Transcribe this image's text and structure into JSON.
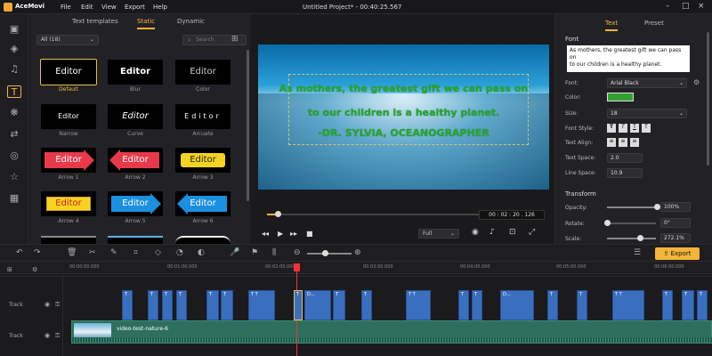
{
  "titlebar": {
    "app": "AceMovi",
    "menus": [
      "File",
      "Edit",
      "View",
      "Export",
      "Help"
    ],
    "title": "Untitled Project* - 00:40:25.567"
  },
  "library": {
    "tabs": [
      "Text templates",
      "Static",
      "Dynamic"
    ],
    "filter": "All (18)",
    "search_placeholder": "Search",
    "tiles": [
      {
        "text": "Editor",
        "label": "Default"
      },
      {
        "text": "Editor",
        "label": "Blur"
      },
      {
        "text": "Editor",
        "label": "Color"
      },
      {
        "text": "Editor",
        "label": "Narrow"
      },
      {
        "text": "Editor",
        "label": "Curve"
      },
      {
        "text": "Editor",
        "label": "Arcuate"
      },
      {
        "text": "Editor",
        "label": "Arrow 1"
      },
      {
        "text": "Editor",
        "label": "Arrow 2"
      },
      {
        "text": "Editor",
        "label": "Arrow 3"
      },
      {
        "text": "Editor",
        "label": "Arrow 4"
      },
      {
        "text": "Editor",
        "label": "Arrow 5"
      },
      {
        "text": "Editor",
        "label": "Arrow 6"
      }
    ]
  },
  "preview": {
    "lines": [
      "As mothers, the greatest gift we can pass on",
      "to our children is a healthy planet.",
      "-DR. SYLVIA, OCEANOGRAPHER"
    ],
    "timecode": "00 : 02 : 20 . 126",
    "zoom": "Full",
    "progress": 0.05
  },
  "props": {
    "tabs": [
      "Text",
      "Preset"
    ],
    "font_heading": "Font",
    "text_value": "As mothers, the greatest gift we can pass on\nto our children is a healthy planet.",
    "fields": [
      {
        "label": "Font:",
        "value": "Arial Black"
      },
      {
        "label": "Color:",
        "value": ""
      },
      {
        "label": "Size:",
        "value": "18"
      },
      {
        "label": "Font Style:",
        "value": ""
      },
      {
        "label": "Text Align:",
        "value": ""
      },
      {
        "label": "Text Space:",
        "value": "2.0"
      },
      {
        "label": "Line Space:",
        "value": "10.9"
      }
    ],
    "transform_heading": "Transform",
    "transform": [
      {
        "label": "Opacity:",
        "value": "100%"
      },
      {
        "label": "Rotate:",
        "value": "0°"
      },
      {
        "label": "Scale:",
        "value": "272.1%"
      }
    ],
    "color_value": "#2ea12f"
  },
  "toolbar": {
    "export_label": "Export"
  },
  "timeline": {
    "ticks": [
      "00:00:00.000",
      "00:01:00.000",
      "00:02:00.000",
      "00:03:00.000",
      "00:04:00.000",
      "00:05:00.000",
      "00:06:00.000"
    ],
    "track_label": "Track",
    "video_clip": "video-test-nature-6",
    "clip_label": "D..."
  }
}
